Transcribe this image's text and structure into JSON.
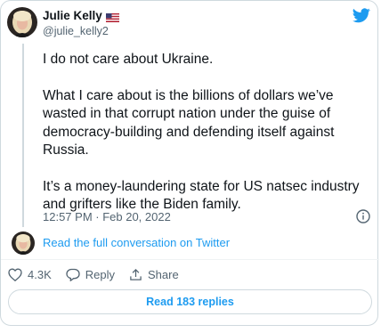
{
  "author": {
    "name": "Julie Kelly",
    "handle": "@julie_kelly2"
  },
  "tweet": {
    "paragraphs": [
      "I do not care about Ukraine.",
      "What I care about is the billions of dollars we’ve wasted in that corrupt nation under the guise of democracy-building and defending itself against Russia.",
      "It’s a money-laundering state for US natsec industry and grifters like the Biden family."
    ],
    "timestamp": "12:57 PM · Feb 20, 2022"
  },
  "conversation_link": "Read the full conversation on Twitter",
  "actions": {
    "likes": "4.3K",
    "reply_label": "Reply",
    "share_label": "Share"
  },
  "replies_button": "Read 183 replies",
  "colors": {
    "accent": "#1d9bf0",
    "muted": "#536471",
    "border": "#cfd9de"
  },
  "icons": [
    "twitter-bird-icon",
    "us-flag-icon",
    "info-icon",
    "heart-icon",
    "reply-icon",
    "share-icon"
  ]
}
